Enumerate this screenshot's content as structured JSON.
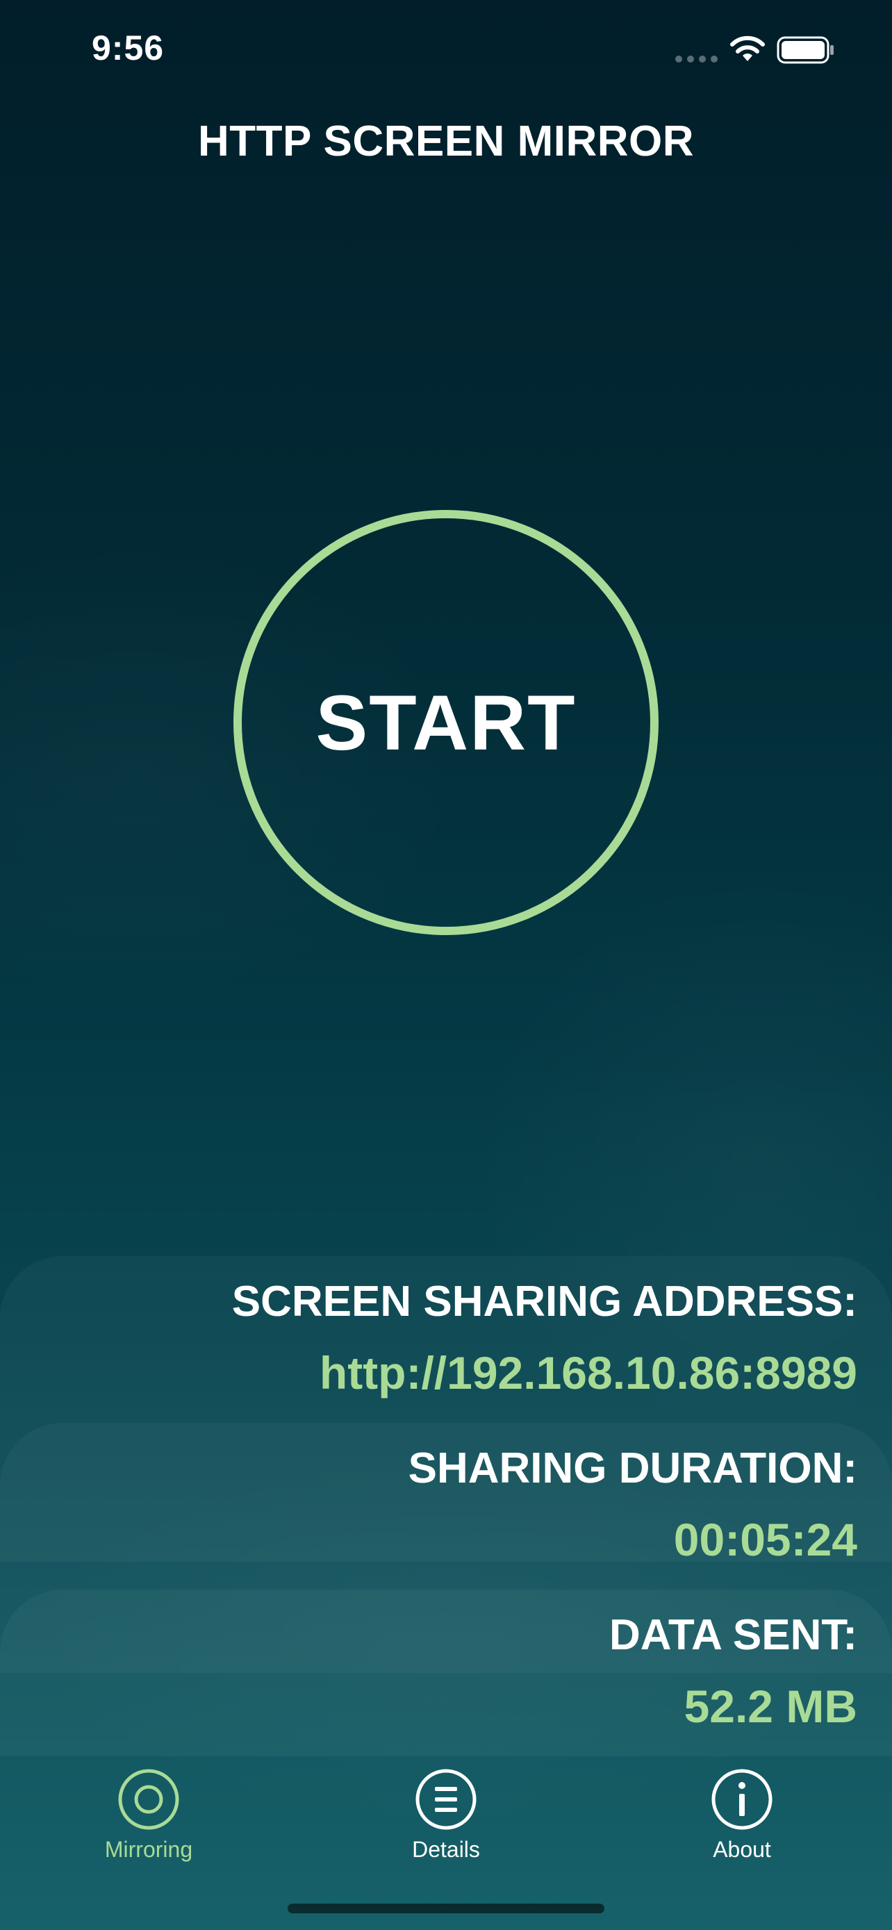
{
  "status_bar": {
    "time": "9:56"
  },
  "header": {
    "title": "HTTP SCREEN MIRROR"
  },
  "main": {
    "start_label": "START"
  },
  "info": {
    "address_label": "SCREEN SHARING ADDRESS:",
    "address_value": "http://192.168.10.86:8989",
    "duration_label": "SHARING DURATION:",
    "duration_value": "00:05:24",
    "data_label": "DATA SENT:",
    "data_value": "52.2 MB"
  },
  "tabs": [
    {
      "label": "Mirroring",
      "icon": "mirroring-icon",
      "active": true
    },
    {
      "label": "Details",
      "icon": "list-icon",
      "active": false
    },
    {
      "label": "About",
      "icon": "info-icon",
      "active": false
    }
  ],
  "colors": {
    "accent": "#a9db96",
    "background_top": "#011e2a",
    "background_bottom": "#17616a",
    "text": "#ffffff"
  }
}
